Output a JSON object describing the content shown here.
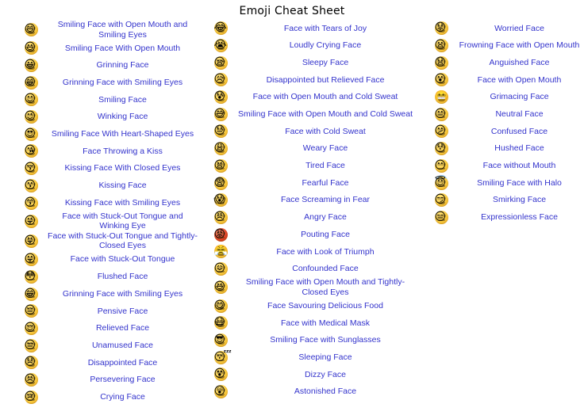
{
  "page": {
    "title": "Emoji Cheat Sheet",
    "text_color": "#3333cc",
    "title_color": "#000000",
    "background": "#ffffff"
  },
  "columns": [
    {
      "id": "left",
      "rows": [
        {
          "emoji": "😄",
          "icon": "grinning-face-with-smiling-eyes-icon",
          "label": "Smiling Face with Open Mouth and Smiling Eyes"
        },
        {
          "emoji": "😃",
          "icon": "smiling-face-with-open-mouth-icon",
          "label": "Smiling Face With Open Mouth"
        },
        {
          "emoji": "😀",
          "icon": "grinning-face-icon",
          "label": "Grinning Face"
        },
        {
          "emoji": "😁",
          "icon": "beaming-face-icon",
          "label": "Grinning Face with Smiling Eyes"
        },
        {
          "emoji": "☺",
          "icon": "smiling-face-icon",
          "label": "Smiling Face"
        },
        {
          "emoji": "😉",
          "icon": "winking-face-icon",
          "label": "Winking Face"
        },
        {
          "emoji": "😍",
          "icon": "heart-eyes-face-icon",
          "label": "Smiling Face With Heart-Shaped Eyes"
        },
        {
          "emoji": "😘",
          "icon": "face-blowing-a-kiss-icon",
          "label": "Face Throwing a Kiss"
        },
        {
          "emoji": "😚",
          "icon": "kissing-face-closed-eyes-icon",
          "label": "Kissing Face With Closed Eyes"
        },
        {
          "emoji": "😗",
          "icon": "kissing-face-icon",
          "label": "Kissing Face"
        },
        {
          "emoji": "😙",
          "icon": "kissing-face-smiling-eyes-icon",
          "label": "Kissing Face with Smiling Eyes"
        },
        {
          "emoji": "😜",
          "icon": "winking-face-tongue-icon",
          "label": "Face with Stuck-Out Tongue and Winking Eye"
        },
        {
          "emoji": "😝",
          "icon": "squinting-face-tongue-icon",
          "label": "Face with Stuck-Out Tongue and Tightly-Closed Eyes"
        },
        {
          "emoji": "😛",
          "icon": "face-with-tongue-icon",
          "label": "Face with Stuck-Out Tongue"
        },
        {
          "emoji": "😳",
          "icon": "flushed-face-icon",
          "label": "Flushed Face"
        },
        {
          "emoji": "😁",
          "icon": "grinning-face-smiling-eyes-icon",
          "label": "Grinning Face with Smiling Eyes"
        },
        {
          "emoji": "😔",
          "icon": "pensive-face-icon",
          "label": "Pensive Face"
        },
        {
          "emoji": "😌",
          "icon": "relieved-face-icon",
          "label": "Relieved Face"
        },
        {
          "emoji": "😒",
          "icon": "unamused-face-icon",
          "label": "Unamused Face"
        },
        {
          "emoji": "😞",
          "icon": "disappointed-face-icon",
          "label": "Disappointed Face"
        },
        {
          "emoji": "😣",
          "icon": "persevering-face-icon",
          "label": "Persevering Face"
        },
        {
          "emoji": "😢",
          "icon": "crying-face-icon",
          "label": "Crying Face"
        }
      ]
    },
    {
      "id": "middle",
      "rows": [
        {
          "emoji": "😂",
          "icon": "face-with-tears-of-joy-icon",
          "label": "Face with Tears of Joy"
        },
        {
          "emoji": "😭",
          "icon": "loudly-crying-face-icon",
          "label": "Loudly Crying Face"
        },
        {
          "emoji": "😪",
          "icon": "sleepy-face-icon",
          "label": "Sleepy Face"
        },
        {
          "emoji": "😥",
          "icon": "sad-but-relieved-face-icon",
          "label": "Disappointed but Relieved Face"
        },
        {
          "emoji": "😰",
          "icon": "anxious-face-with-sweat-icon",
          "label": "Face with Open Mouth and Cold Sweat"
        },
        {
          "emoji": "😅",
          "icon": "grinning-face-with-sweat-icon",
          "label": "Smiling Face with Open Mouth and Cold Sweat"
        },
        {
          "emoji": "😓",
          "icon": "downcast-face-with-sweat-icon",
          "label": "Face with Cold Sweat"
        },
        {
          "emoji": "😩",
          "icon": "weary-face-icon",
          "label": "Weary Face"
        },
        {
          "emoji": "😫",
          "icon": "tired-face-icon",
          "label": "Tired Face"
        },
        {
          "emoji": "😨",
          "icon": "fearful-face-icon",
          "label": "Fearful Face"
        },
        {
          "emoji": "😱",
          "icon": "face-screaming-in-fear-icon",
          "label": "Face Screaming in Fear"
        },
        {
          "emoji": "😠",
          "icon": "angry-face-icon",
          "label": "Angry Face"
        },
        {
          "emoji": "😡",
          "icon": "pouting-face-icon",
          "label": "Pouting Face"
        },
        {
          "emoji": "😤",
          "icon": "face-with-steam-from-nose-icon",
          "label": "Face with Look of Triumph"
        },
        {
          "emoji": "😖",
          "icon": "confounded-face-icon",
          "label": "Confounded Face"
        },
        {
          "emoji": "😆",
          "icon": "grinning-squinting-face-icon",
          "label": "Smiling Face with Open Mouth and Tightly-Closed Eyes"
        },
        {
          "emoji": "😋",
          "icon": "face-savoring-food-icon",
          "label": "Face Savouring Delicious Food"
        },
        {
          "emoji": "😷",
          "icon": "face-with-medical-mask-icon",
          "label": "Face with Medical Mask"
        },
        {
          "emoji": "😎",
          "icon": "smiling-face-with-sunglasses-icon",
          "label": "Smiling Face with Sunglasses"
        },
        {
          "emoji": "😴",
          "icon": "sleeping-face-icon",
          "label": "Sleeping Face"
        },
        {
          "emoji": "😵",
          "icon": "dizzy-face-icon",
          "label": "Dizzy Face"
        },
        {
          "emoji": "😲",
          "icon": "astonished-face-icon",
          "label": "Astonished Face"
        }
      ]
    },
    {
      "id": "right",
      "rows": [
        {
          "emoji": "😟",
          "icon": "worried-face-icon",
          "label": "Worried Face"
        },
        {
          "emoji": "😦",
          "icon": "frowning-face-with-open-mouth-icon",
          "label": "Frowning Face with Open Mouth"
        },
        {
          "emoji": "😧",
          "icon": "anguished-face-icon",
          "label": "Anguished Face"
        },
        {
          "emoji": "😮",
          "icon": "face-with-open-mouth-icon",
          "label": "Face with Open Mouth"
        },
        {
          "emoji": "😬",
          "icon": "grimacing-face-icon",
          "label": "Grimacing Face"
        },
        {
          "emoji": "😐",
          "icon": "neutral-face-icon",
          "label": "Neutral Face"
        },
        {
          "emoji": "😕",
          "icon": "confused-face-icon",
          "label": "Confused Face"
        },
        {
          "emoji": "😯",
          "icon": "hushed-face-icon",
          "label": "Hushed Face"
        },
        {
          "emoji": "😶",
          "icon": "face-without-mouth-icon",
          "label": "Face without Mouth"
        },
        {
          "emoji": "😇",
          "icon": "smiling-face-with-halo-icon",
          "label": "Smiling Face with Halo"
        },
        {
          "emoji": "😏",
          "icon": "smirking-face-icon",
          "label": "Smirking Face"
        },
        {
          "emoji": "😑",
          "icon": "expressionless-face-icon",
          "label": "Expressionless Face"
        }
      ]
    }
  ]
}
